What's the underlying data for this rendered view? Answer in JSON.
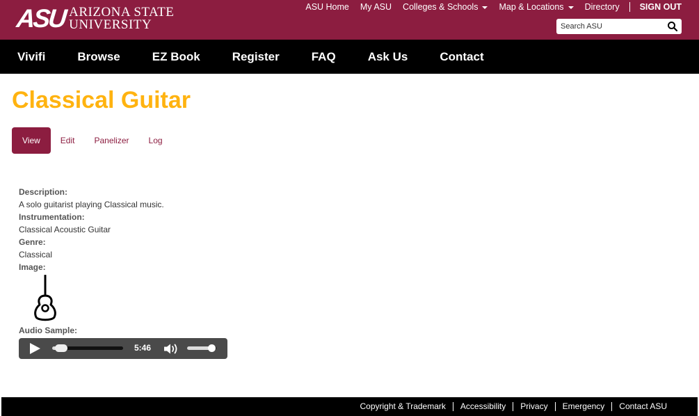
{
  "header": {
    "logo_mark": "ASU",
    "logo_line1": "Arizona State",
    "logo_line2": "University",
    "links": [
      "ASU Home",
      "My ASU",
      "Colleges & Schools",
      "Map & Locations",
      "Directory"
    ],
    "sign_out": "SIGN OUT",
    "search": {
      "placeholder": "Search ASU",
      "icon": "search-icon"
    },
    "brand_color": "#8c1d40"
  },
  "nav": {
    "items": [
      "Vivifi",
      "Browse",
      "EZ Book",
      "Register",
      "FAQ",
      "Ask Us",
      "Contact"
    ]
  },
  "page": {
    "title": "Classical Guitar",
    "title_color": "#ffb310",
    "tabs": [
      {
        "label": "View",
        "active": true
      },
      {
        "label": "Edit",
        "active": false
      },
      {
        "label": "Panelizer",
        "active": false
      },
      {
        "label": "Log",
        "active": false
      }
    ]
  },
  "fields": {
    "description_label": "Description:",
    "description_value": "A solo guitarist playing Classical music.",
    "instrumentation_label": "Instrumentation:",
    "instrumentation_value": "Classical Acoustic Guitar",
    "genre_label": "Genre:",
    "genre_value": "Classical",
    "image_label": "Image:",
    "image_icon": "guitar-icon",
    "audio_label": "Audio Sample:"
  },
  "player": {
    "time": "5:46",
    "progress": 0.04,
    "volume": 0.85,
    "play_icon": "play-icon",
    "volume_icon": "volume-icon"
  },
  "footer": {
    "links": [
      "Copyright & Trademark",
      "Accessibility",
      "Privacy",
      "Emergency",
      "Contact ASU"
    ]
  }
}
